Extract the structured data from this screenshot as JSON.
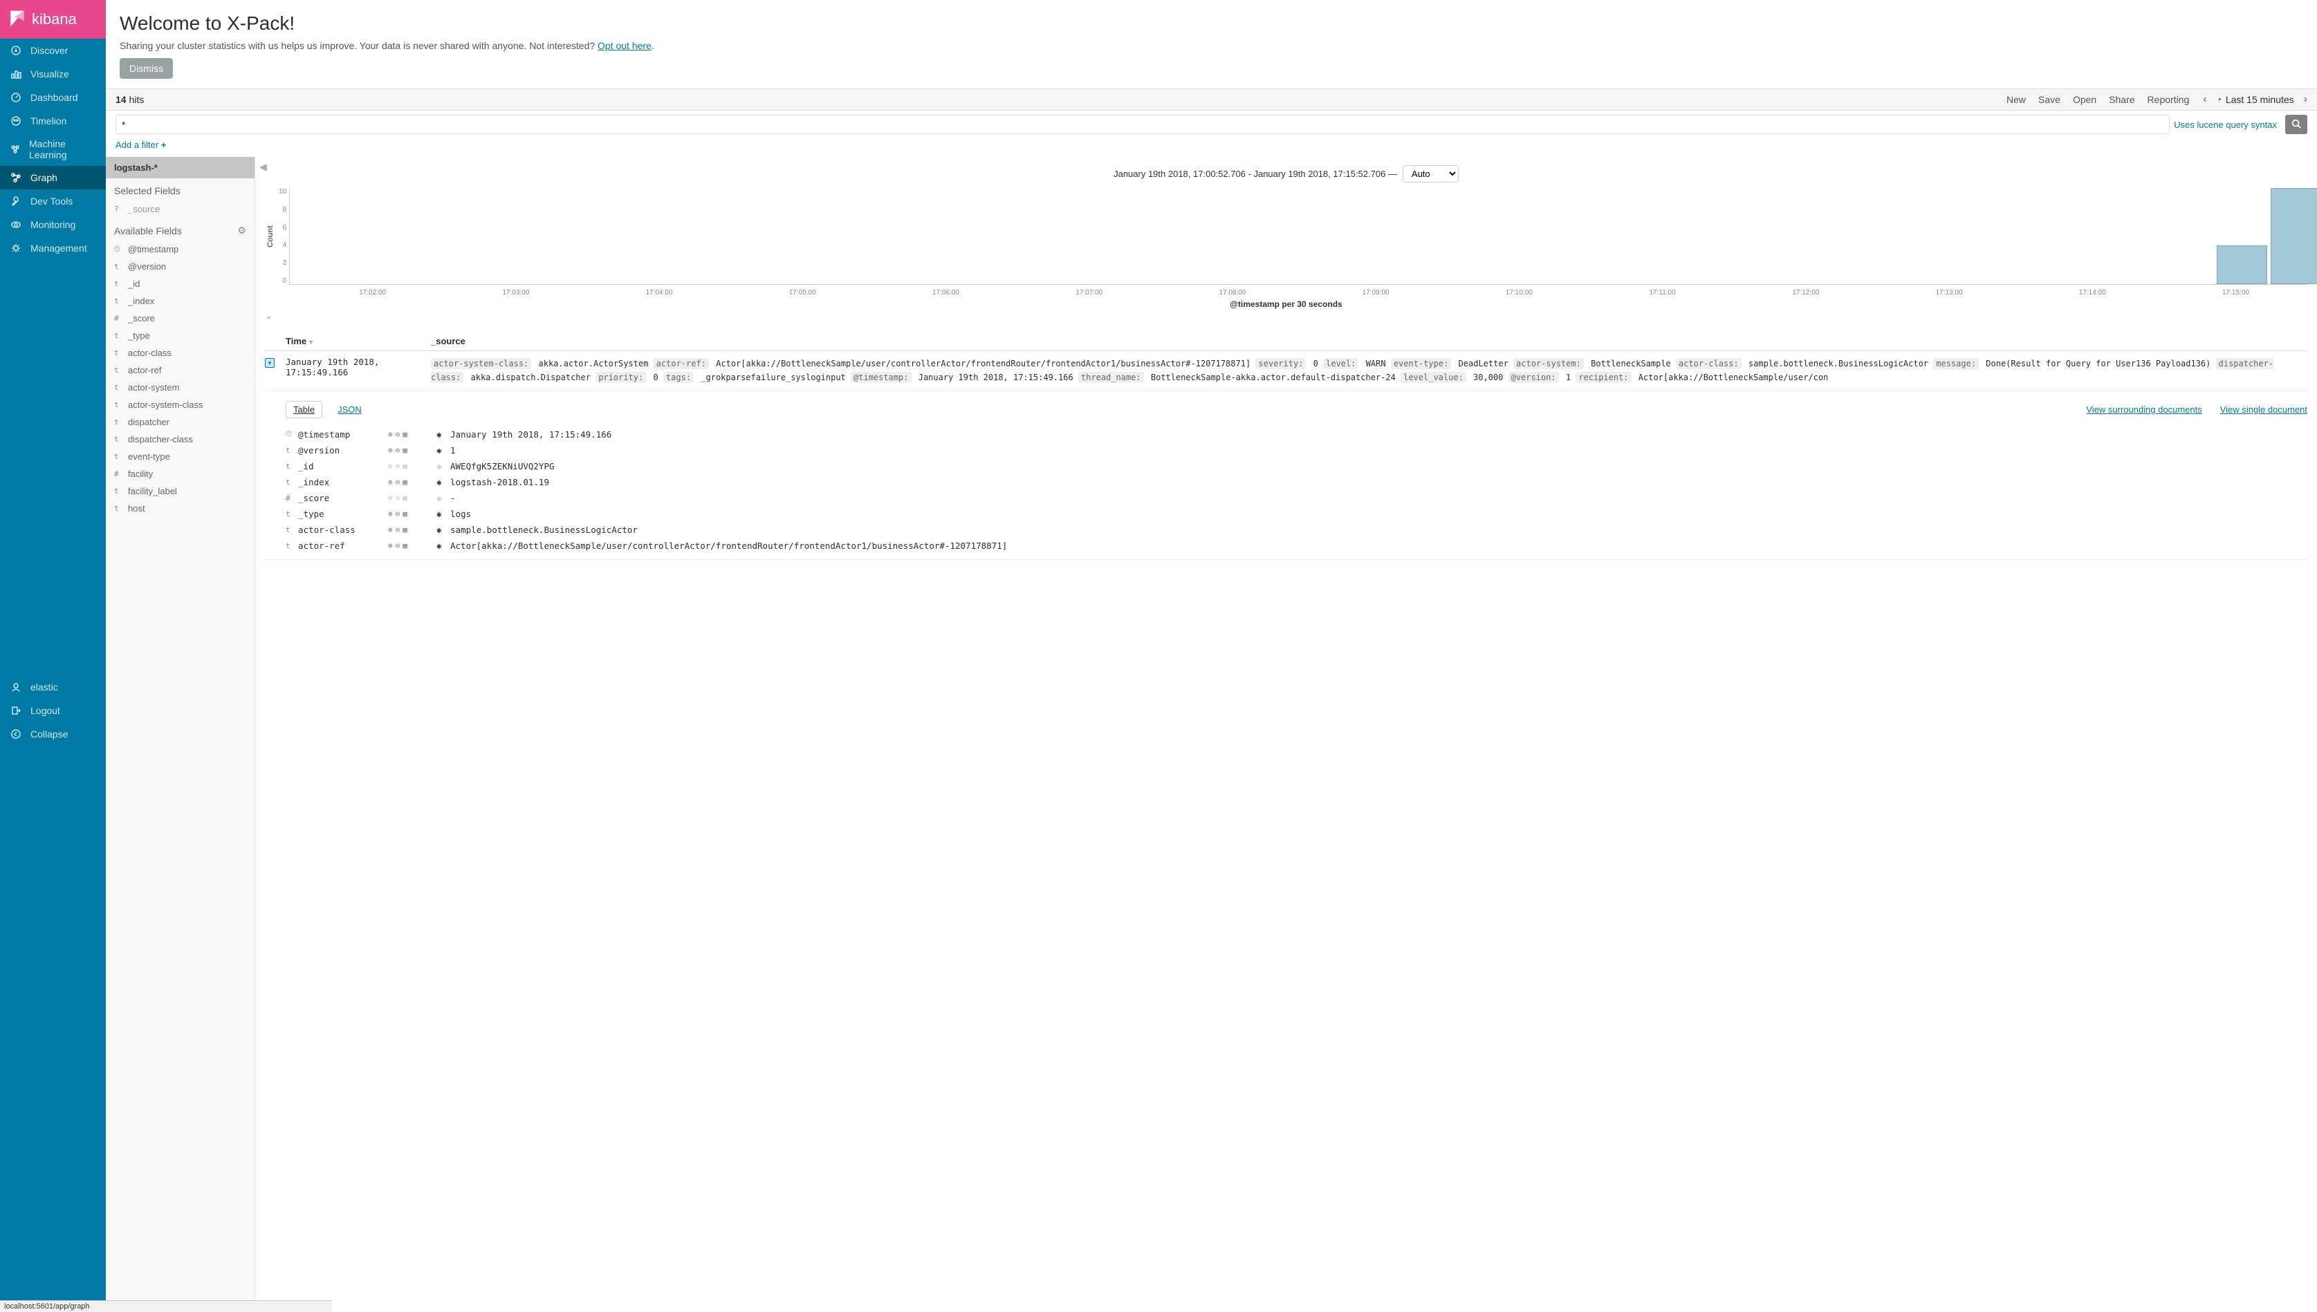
{
  "brand": "kibana",
  "status_url": "localhost:5601/app/graph",
  "nav": {
    "items": [
      {
        "label": "Discover",
        "icon": "compass"
      },
      {
        "label": "Visualize",
        "icon": "barchart"
      },
      {
        "label": "Dashboard",
        "icon": "gauge"
      },
      {
        "label": "Timelion",
        "icon": "timelion"
      },
      {
        "label": "Machine Learning",
        "icon": "ml"
      },
      {
        "label": "Graph",
        "icon": "graph",
        "active": true
      },
      {
        "label": "Dev Tools",
        "icon": "wrench"
      },
      {
        "label": "Monitoring",
        "icon": "eye"
      },
      {
        "label": "Management",
        "icon": "gear"
      }
    ],
    "bottom": [
      {
        "label": "elastic",
        "icon": "user"
      },
      {
        "label": "Logout",
        "icon": "logout"
      },
      {
        "label": "Collapse",
        "icon": "collapse"
      }
    ]
  },
  "banner": {
    "title": "Welcome to X-Pack!",
    "text_pre": "Sharing your cluster statistics with us helps us improve. Your data is never shared with anyone. Not interested? ",
    "opt_out": "Opt out here",
    "dismiss": "Dismiss"
  },
  "toolbar": {
    "hits_count": "14",
    "hits_label": " hits",
    "menu": [
      "New",
      "Save",
      "Open",
      "Share",
      "Reporting"
    ],
    "time_label": "Last 15 minutes"
  },
  "search": {
    "value": "*",
    "syntax_link": "Uses lucene query syntax"
  },
  "filter": {
    "add": "Add a filter "
  },
  "index_pattern": "logstash-*",
  "fields": {
    "selected_title": "Selected Fields",
    "available_title": "Available Fields",
    "selected": [
      {
        "type": "?",
        "name": "_source",
        "italic": true
      }
    ],
    "available": [
      {
        "type": "⏱",
        "name": "@timestamp"
      },
      {
        "type": "t",
        "name": "@version"
      },
      {
        "type": "t",
        "name": "_id"
      },
      {
        "type": "t",
        "name": "_index"
      },
      {
        "type": "#",
        "name": "_score"
      },
      {
        "type": "t",
        "name": "_type"
      },
      {
        "type": "t",
        "name": "actor-class"
      },
      {
        "type": "t",
        "name": "actor-ref"
      },
      {
        "type": "t",
        "name": "actor-system"
      },
      {
        "type": "t",
        "name": "actor-system-class"
      },
      {
        "type": "t",
        "name": "dispatcher"
      },
      {
        "type": "t",
        "name": "dispatcher-class"
      },
      {
        "type": "t",
        "name": "event-type"
      },
      {
        "type": "#",
        "name": "facility"
      },
      {
        "type": "t",
        "name": "facility_label"
      },
      {
        "type": "t",
        "name": "host"
      }
    ]
  },
  "timerange": {
    "text": "January 19th 2018, 17:00:52.706 - January 19th 2018, 17:15:52.706 —",
    "interval": "Auto"
  },
  "chart_data": {
    "type": "bar",
    "ylabel": "Count",
    "xlabel": "@timestamp per 30 seconds",
    "y_ticks": [
      "10",
      "8",
      "6",
      "4",
      "2",
      "0"
    ],
    "ylim": [
      0,
      10
    ],
    "x_ticks": [
      "17:02:00",
      "17:03:00",
      "17:04:00",
      "17:05:00",
      "17:06:00",
      "17:07:00",
      "17:08:00",
      "17:09:00",
      "17:10:00",
      "17:11:00",
      "17:12:00",
      "17:13:00",
      "17:14:00",
      "17:15:00"
    ],
    "bars": [
      {
        "x_pct": 95.5,
        "value": 4
      },
      {
        "x_pct": 98.2,
        "value": 10
      }
    ]
  },
  "doc_header": {
    "time": "Time",
    "source": "_source"
  },
  "doc": {
    "time": "January 19th 2018, 17:15:49.166",
    "kv": [
      {
        "k": "actor-system-class:",
        "v": "akka.actor.ActorSystem"
      },
      {
        "k": "actor-ref:",
        "v": "Actor[akka://BottleneckSample/user/controllerActor/frontendRouter/frontendActor1/businessActor#-1207178871]"
      },
      {
        "k": "severity:",
        "v": "0"
      },
      {
        "k": "level:",
        "v": "WARN"
      },
      {
        "k": "event-type:",
        "v": "DeadLetter"
      },
      {
        "k": "actor-system:",
        "v": "BottleneckSample"
      },
      {
        "k": "actor-class:",
        "v": "sample.bottleneck.BusinessLogicActor"
      },
      {
        "k": "message:",
        "v": "Done(Result for Query for User136 Payload136)"
      },
      {
        "k": "dispatcher-class:",
        "v": "akka.dispatch.Dispatcher"
      },
      {
        "k": "priority:",
        "v": "0"
      },
      {
        "k": "tags:",
        "v": "_grokparsefailure_sysloginput"
      },
      {
        "k": "@timestamp:",
        "v": "January 19th 2018, 17:15:49.166"
      },
      {
        "k": "thread_name:",
        "v": "BottleneckSample-akka.actor.default-dispatcher-24"
      },
      {
        "k": "level_value:",
        "v": "30,000"
      },
      {
        "k": "@version:",
        "v": "1"
      },
      {
        "k": "recipient:",
        "v": "Actor[akka://BottleneckSample/user/con"
      }
    ]
  },
  "detail": {
    "tabs": {
      "table": "Table",
      "json": "JSON"
    },
    "links": {
      "surrounding": "View surrounding documents",
      "single": "View single document"
    },
    "rows": [
      {
        "type": "⏱",
        "name": "@timestamp",
        "dim": false,
        "value": "January 19th 2018, 17:15:49.166"
      },
      {
        "type": "t",
        "name": "@version",
        "dim": false,
        "value": "1"
      },
      {
        "type": "t",
        "name": "_id",
        "dim": true,
        "value": "AWEQfgK5ZEKNiUVQ2YPG"
      },
      {
        "type": "t",
        "name": "_index",
        "dim": false,
        "value": "logstash-2018.01.19"
      },
      {
        "type": "#",
        "name": "_score",
        "dim": true,
        "value": "-"
      },
      {
        "type": "t",
        "name": "_type",
        "dim": false,
        "value": "logs"
      },
      {
        "type": "t",
        "name": "actor-class",
        "dim": false,
        "value": "sample.bottleneck.BusinessLogicActor"
      },
      {
        "type": "t",
        "name": "actor-ref",
        "dim": false,
        "value": "Actor[akka://BottleneckSample/user/controllerActor/frontendRouter/frontendActor1/businessActor#-1207178871]"
      }
    ]
  }
}
